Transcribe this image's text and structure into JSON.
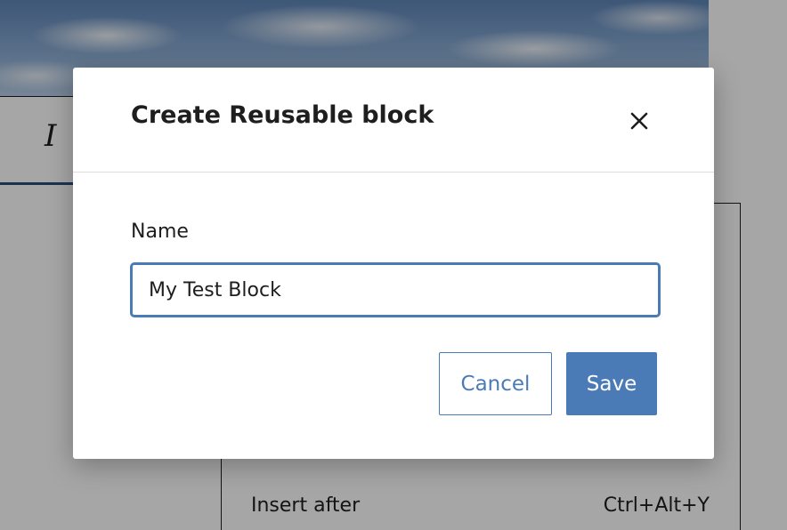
{
  "background": {
    "toolbar_italic_glyph": "I",
    "menu_item": {
      "label": "Insert after",
      "shortcut": "Ctrl+Alt+Y"
    }
  },
  "modal": {
    "title": "Create Reusable block",
    "close_glyph": "×",
    "name_label": "Name",
    "name_value": "My Test Block",
    "cancel_label": "Cancel",
    "save_label": "Save",
    "accent_color": "#4a7bb7"
  }
}
